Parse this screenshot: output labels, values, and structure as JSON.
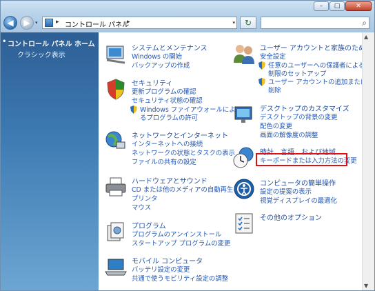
{
  "window": {
    "minimize": "–",
    "maximize": "□",
    "close": "✕"
  },
  "nav": {
    "back_glyph": "◀",
    "forward_glyph": "▶",
    "menu_glyph": "▾",
    "address_path": [
      "コントロール パネル"
    ],
    "address_separator": "▸",
    "refresh_glyph": "↻",
    "search_placeholder": "",
    "search_icon": "⌕",
    "dropdown_glyph": "▾"
  },
  "sidebar": {
    "home": "コントロール パネル ホーム",
    "classic": "クラシック表示"
  },
  "categories": [
    {
      "id": "system",
      "title": "システムとメンテナンス",
      "links": [
        {
          "text": "Windows の開始",
          "indent": false,
          "shield": false
        },
        {
          "text": "バックアップの作成",
          "indent": false,
          "shield": false
        }
      ]
    },
    {
      "id": "security",
      "title": "セキュリティ",
      "links": [
        {
          "text": "更新プログラムの確認",
          "indent": false,
          "shield": false
        },
        {
          "text": "セキュリティ状態の確認",
          "indent": false,
          "shield": false
        },
        {
          "text": "Windows ファイアウォールによ",
          "indent": true,
          "shield": true
        },
        {
          "text": "るプログラムの許可",
          "indent": true,
          "shield": false
        }
      ]
    },
    {
      "id": "network",
      "title": "ネットワークとインターネット",
      "links": [
        {
          "text": "インターネットへの接続",
          "indent": false,
          "shield": false
        },
        {
          "text": "ネットワークの状態とタスクの表示",
          "indent": false,
          "shield": false
        },
        {
          "text": "ファイルの共有の設定",
          "indent": false,
          "shield": false
        }
      ]
    },
    {
      "id": "hardware",
      "title": "ハードウェアとサウンド",
      "links": [
        {
          "text": "CD または他のメディアの自動再生",
          "indent": false,
          "shield": false
        },
        {
          "text": "プリンタ",
          "indent": false,
          "shield": false
        },
        {
          "text": "マウス",
          "indent": false,
          "shield": false
        }
      ]
    },
    {
      "id": "programs",
      "title": "プログラム",
      "links": [
        {
          "text": "プログラムのアンインストール",
          "indent": false,
          "shield": false
        },
        {
          "text": "スタートアップ プログラムの変更",
          "indent": false,
          "shield": false
        }
      ]
    },
    {
      "id": "mobile",
      "title": "モバイル コンピュータ",
      "links": [
        {
          "text": "バッテリ設定の変更",
          "indent": false,
          "shield": false
        },
        {
          "text": "共通で使うモビリティ設定の調整",
          "indent": false,
          "shield": false
        }
      ]
    },
    {
      "id": "users",
      "title": "ユーザー アカウントと家族のための",
      "links": [
        {
          "text": "安全設定",
          "indent": false,
          "shield": false
        },
        {
          "text": "任意のユーザーへの保護者による",
          "indent": true,
          "shield": true
        },
        {
          "text": "制限のセットアップ",
          "indent": true,
          "shield": false
        },
        {
          "text": "ユーザー アカウントの追加または",
          "indent": true,
          "shield": true
        },
        {
          "text": "削除",
          "indent": true,
          "shield": false
        }
      ]
    },
    {
      "id": "desktop",
      "title": "デスクトップのカスタマイズ",
      "links": [
        {
          "text": "デスクトップの背景の変更",
          "indent": false,
          "shield": false
        },
        {
          "text": "配色の変更",
          "indent": false,
          "shield": false
        },
        {
          "text": "画面の解像度の調整",
          "indent": false,
          "shield": false
        }
      ]
    },
    {
      "id": "clock",
      "title": "時計、言語、および地域",
      "links": [
        {
          "text": "キーボードまたは入力方法の変更",
          "indent": false,
          "shield": false
        }
      ]
    },
    {
      "id": "ease",
      "title": "コンピュータの簡単操作",
      "links": [
        {
          "text": "設定の提案の表示",
          "indent": false,
          "shield": false
        },
        {
          "text": "視覚ディスプレイの最適化",
          "indent": false,
          "shield": false
        }
      ]
    },
    {
      "id": "other",
      "title": "その他のオプション",
      "links": []
    }
  ],
  "highlight_color": "#e01010",
  "link_color": "#2358b5",
  "title_color": "#1f4d9e"
}
